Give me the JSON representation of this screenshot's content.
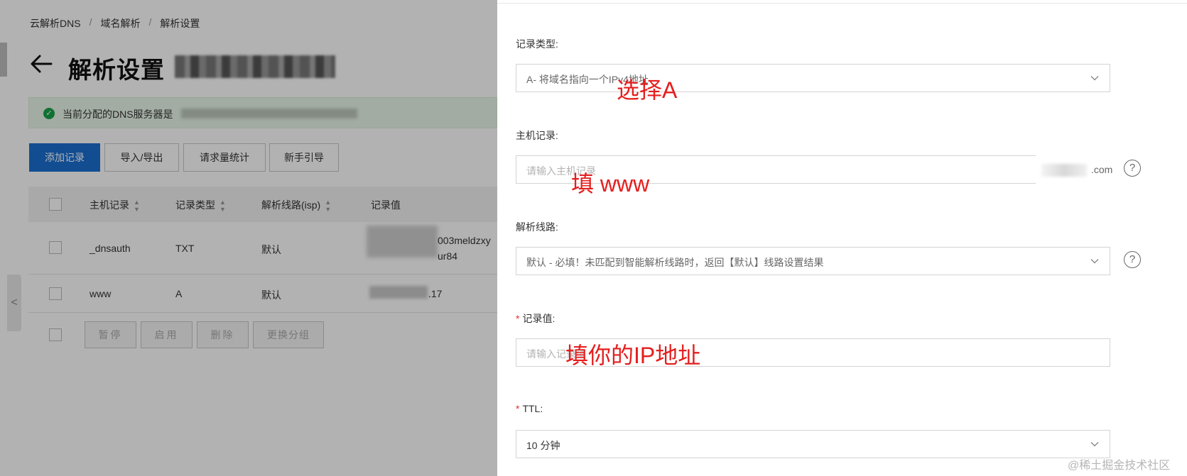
{
  "breadcrumb": {
    "item1": "云解析DNS",
    "item2": "域名解析",
    "item3": "解析设置",
    "sep": "/"
  },
  "page": {
    "title": "解析设置"
  },
  "notice": {
    "text": "当前分配的DNS服务器是"
  },
  "toolbar": {
    "add": "添加记录",
    "import_export": "导入/导出",
    "stats": "请求量统计",
    "guide": "新手引导"
  },
  "table": {
    "headers": {
      "host": "主机记录",
      "type": "记录类型",
      "line": "解析线路(isp)",
      "value": "记录值"
    },
    "rows": [
      {
        "host": "_dnsauth",
        "type": "TXT",
        "line": "默认",
        "value_a": "003meldzxy",
        "value_b": "ur84"
      },
      {
        "host": "www",
        "type": "A",
        "line": "默认",
        "value_a": ".17"
      }
    ],
    "batch": {
      "pause": "暂停",
      "enable": "启用",
      "delete": "删除",
      "group": "更换分组"
    }
  },
  "drawer": {
    "record_type": {
      "label": "记录类型:",
      "value": "A- 将域名指向一个IPv4地址"
    },
    "host": {
      "label": "主机记录:",
      "placeholder": "请输入主机记录",
      "suffix": ".com"
    },
    "line": {
      "label": "解析线路:",
      "value": "默认 - 必填！未匹配到智能解析线路时，返回【默认】线路设置结果"
    },
    "record_value": {
      "label": "记录值:",
      "placeholder": "请输入记录值"
    },
    "ttl": {
      "label": "TTL:",
      "value": "10 分钟"
    },
    "required_mark": "*"
  },
  "annotations": {
    "a": "选择A",
    "b": "填 www",
    "c": "填你的IP地址"
  },
  "watermark": "@稀土掘金技术社区",
  "icons": {
    "help": "?",
    "chevron": "chevron-down-icon",
    "check": "✓",
    "collapse": "<"
  }
}
